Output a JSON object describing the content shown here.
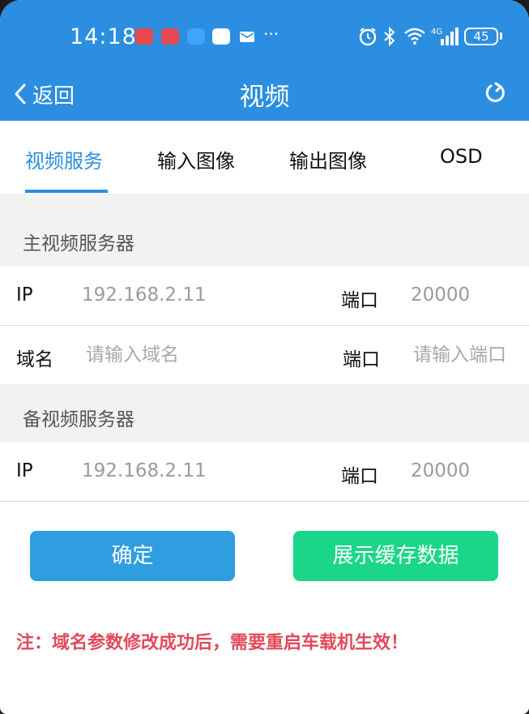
{
  "status_bar": {
    "time": "14:18",
    "more": "···",
    "battery": "45"
  },
  "header": {
    "back_label": "返回",
    "title": "视频"
  },
  "tabs": [
    {
      "label": "视频服务",
      "active": true
    },
    {
      "label": "输入图像",
      "active": false
    },
    {
      "label": "输出图像",
      "active": false
    },
    {
      "label": "OSD",
      "active": false
    }
  ],
  "main_server": {
    "section_title": "主视频服务器",
    "ip_label": "IP",
    "ip_value": "192.168.2.11",
    "port_label": "端口",
    "port_value": "20000",
    "domain_label": "域名",
    "domain_placeholder": "请输入域名",
    "domain_port_label": "端口",
    "domain_port_placeholder": "请输入端口"
  },
  "backup_server": {
    "section_title": "备视频服务器",
    "ip_label": "IP",
    "ip_value": "192.168.2.11",
    "port_label": "端口",
    "port_value": "20000"
  },
  "buttons": {
    "confirm": "确定",
    "show_cache": "展示缓存数据"
  },
  "note": "注：域名参数修改成功后，需要重启车载机生效！",
  "colors": {
    "header_blue": "#2b8ee0",
    "confirm_button": "#2f9ee0",
    "cache_button": "#1bd688",
    "note_red": "#e24a5a"
  }
}
